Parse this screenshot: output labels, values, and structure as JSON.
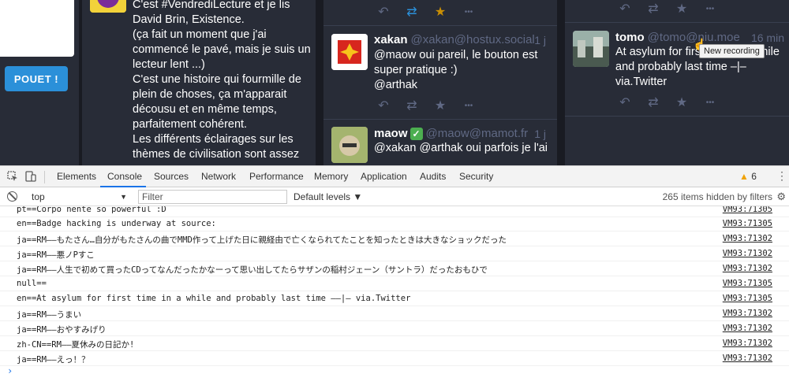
{
  "compose": {
    "button_label": "POUET !"
  },
  "column1": {
    "status": {
      "lines": [
        "C'est #VendrediLecture et je lis",
        "David Brin, Existence.",
        "(ça fait un moment que j'ai",
        "commencé le pavé, mais je suis un",
        "lecteur lent ...)",
        "C'est une histoire qui fourmille de",
        "plein de choses, ça m'apparait",
        "décousu et en même temps,",
        "parfaitement cohérent.",
        "Les différents éclairages sur les",
        "thèmes de civilisation sont assez"
      ]
    }
  },
  "column2": {
    "statuses": [
      {
        "name": "xakan",
        "acct": "@xakan@hostux.social",
        "time": "1 j",
        "lines": [
          "@maow oui pareil, le bouton est",
          "super pratique :)",
          "@arthak"
        ]
      },
      {
        "name": "maow",
        "verified": "✓",
        "acct": "@maow@mamot.fr",
        "time": "1 j",
        "lines": [
          "@xakan @arthak oui parfois je l'ai"
        ]
      }
    ]
  },
  "column3": {
    "status": {
      "name": "tomo",
      "acct": "@tomo@niu.moe",
      "time": "16 min",
      "lines": [
        "At asylum for first time in a while",
        "and probably last time –|–",
        "via.Twitter"
      ]
    },
    "tooltip": "New recording"
  },
  "icons": {
    "reply": "↶",
    "boost": "⇄",
    "favourite": "★",
    "more": "•••"
  },
  "colors": {
    "mastodon_bg": "#191b22",
    "column_bg": "#282c37",
    "accent": "#2b90d9",
    "favourite": "#ca8f04",
    "devtools_tab_active": "#1a73e8"
  },
  "devtools": {
    "tabs": [
      "Elements",
      "Console",
      "Sources",
      "Network",
      "Performance",
      "Memory",
      "Application",
      "Audits",
      "Security"
    ],
    "active_tab": "Console",
    "warning_count": "6",
    "context": "top",
    "filter_placeholder": "Filter",
    "levels": "Default levels ▼",
    "hidden_count": "265 items hidden by filters",
    "logs": [
      {
        "msg": "pt==Corpo nente so powerful :D",
        "src": "VM93:71305"
      },
      {
        "msg": "en==Badge hacking is underway at   source:",
        "src": "VM93:71305"
      },
      {
        "msg": "ja==RM––もたさん…自分がもたさんの曲でMMD作って上げた日に親経由で亡くなられてたことを知ったときは大きなショックだった",
        "src": "VM93:71302"
      },
      {
        "msg": "ja==RM––悪ノPすこ",
        "src": "VM93:71302"
      },
      {
        "msg": "ja==RM––人生で初めて買ったCDってなんだったかなーって思い出してたらサザンの稲村ジェーン（サントラ）だったおもひで",
        "src": "VM93:71302"
      },
      {
        "msg": "null==",
        "src": "VM93:71305"
      },
      {
        "msg": "en==At asylum for first time in a while and probably last time ––|– via.Twitter",
        "src": "VM93:71305"
      },
      {
        "msg": "ja==RM––うまい",
        "src": "VM93:71302"
      },
      {
        "msg": "ja==RM––おやすみげり",
        "src": "VM93:71302"
      },
      {
        "msg": "zh-CN==RM––夏休みの日記か!",
        "src": "VM93:71302"
      },
      {
        "msg": "ja==RM––えっ！？",
        "src": "VM93:71302"
      }
    ],
    "prompt": "›"
  }
}
